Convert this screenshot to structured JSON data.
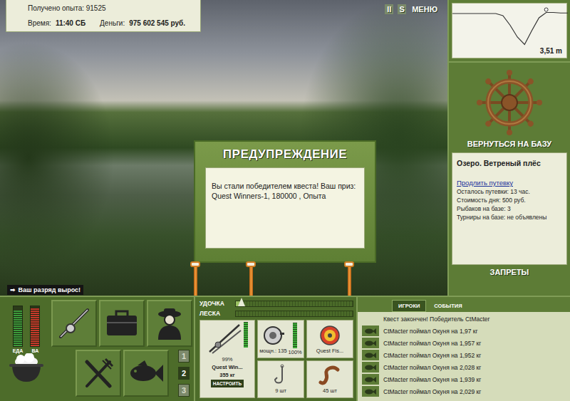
{
  "stats": {
    "experience": "Получено опыта: 91525",
    "time_label": "Время:",
    "time": "11:40 СБ",
    "money_label": "Деньги:",
    "money": "975 602 545 руб."
  },
  "top_buttons": [
    "II",
    "S",
    "МЕНЮ"
  ],
  "rank_notice": {
    "icon": "➡",
    "text": "Ваш разряд вырос!"
  },
  "dialog": {
    "title": "ПРЕДУПРЕЖДЕНИЕ",
    "message": "Вы стали победителем квеста! Ваш приз: Quest Winners-1, 180000 , Опыта"
  },
  "rod_stands": [
    {
      "occupied": false
    },
    {
      "occupied": false
    },
    {
      "occupied": false
    }
  ],
  "depth_chart": {
    "reading": "3,51 m",
    "values": [
      0.4,
      0.4,
      0.4,
      0.4,
      0.4,
      0.4,
      0.4,
      0.6,
      1.5,
      2.6,
      3.3,
      2.0,
      0.8,
      0.3,
      0.3,
      0.35,
      0.35
    ],
    "marker_index": 13
  },
  "base": {
    "button": "ВЕРНУТЬСЯ НА БАЗУ",
    "location": "Озеро. Ветреный плёс",
    "link": "Продлить путевку",
    "info": [
      "Осталось путевки: 13 час.",
      "Стоимость дня: 500 руб.",
      "Рыбаков на базе: 3",
      "Турниры на базе: не объявлены"
    ],
    "bans": "ЗАПРЕТЫ"
  },
  "needs": [
    {
      "label": "ЕДА",
      "level": 0.9,
      "color": "#3c9a3a"
    },
    {
      "label": "ВА",
      "level": 0.97,
      "color": "#c8392a"
    }
  ],
  "tools": [
    {
      "kind": "rod"
    },
    {
      "kind": "box"
    },
    {
      "kind": "fisherman"
    },
    {
      "kind": "cutlery"
    },
    {
      "kind": "fish"
    }
  ],
  "slots": [
    {
      "label": "1",
      "selected": false
    },
    {
      "label": "2",
      "selected": true
    },
    {
      "label": "3",
      "selected": false
    }
  ],
  "gauges": [
    {
      "label": "УДОЧКА",
      "level": 0.05,
      "marker": true
    },
    {
      "label": "ЛЕСКА",
      "level": 0,
      "marker": false
    }
  ],
  "tackle": {
    "rod": {
      "name": "Quest Win...",
      "weight": "355 кг",
      "level": 0.99,
      "reading": "99%"
    },
    "reel": {
      "power": "мощн.: 135",
      "level": 1,
      "reading": "100%"
    },
    "line": {
      "name": "Quest Fis..."
    },
    "hook": {
      "count": "9 шт"
    },
    "bait": {
      "count": "45 шт"
    },
    "setup": "НАСТРОИТЬ"
  },
  "chat": {
    "tabs": [
      {
        "label": "ИГРОКИ",
        "selected": true
      },
      {
        "label": "СОБЫТИЯ",
        "selected": false
      }
    ],
    "messages": [
      {
        "kind": "system",
        "text": "Квест закончен! Победитель CtMacter"
      },
      {
        "kind": "catch",
        "text": "CtMacter поймал Окуня на 1,97 кг"
      },
      {
        "kind": "catch",
        "text": "CtMacter поймал Окуня на 1,957 кг"
      },
      {
        "kind": "catch",
        "text": "CtMacter поймал Окуня на 1,952 кг"
      },
      {
        "kind": "catch",
        "text": "CtMacter поймал Окуня на 2,028 кг"
      },
      {
        "kind": "catch",
        "text": "CtMacter поймал Окуня на 1,939 кг"
      },
      {
        "kind": "catch",
        "text": "CtMacter поймал Окуня на 2,029 кг"
      }
    ]
  }
}
